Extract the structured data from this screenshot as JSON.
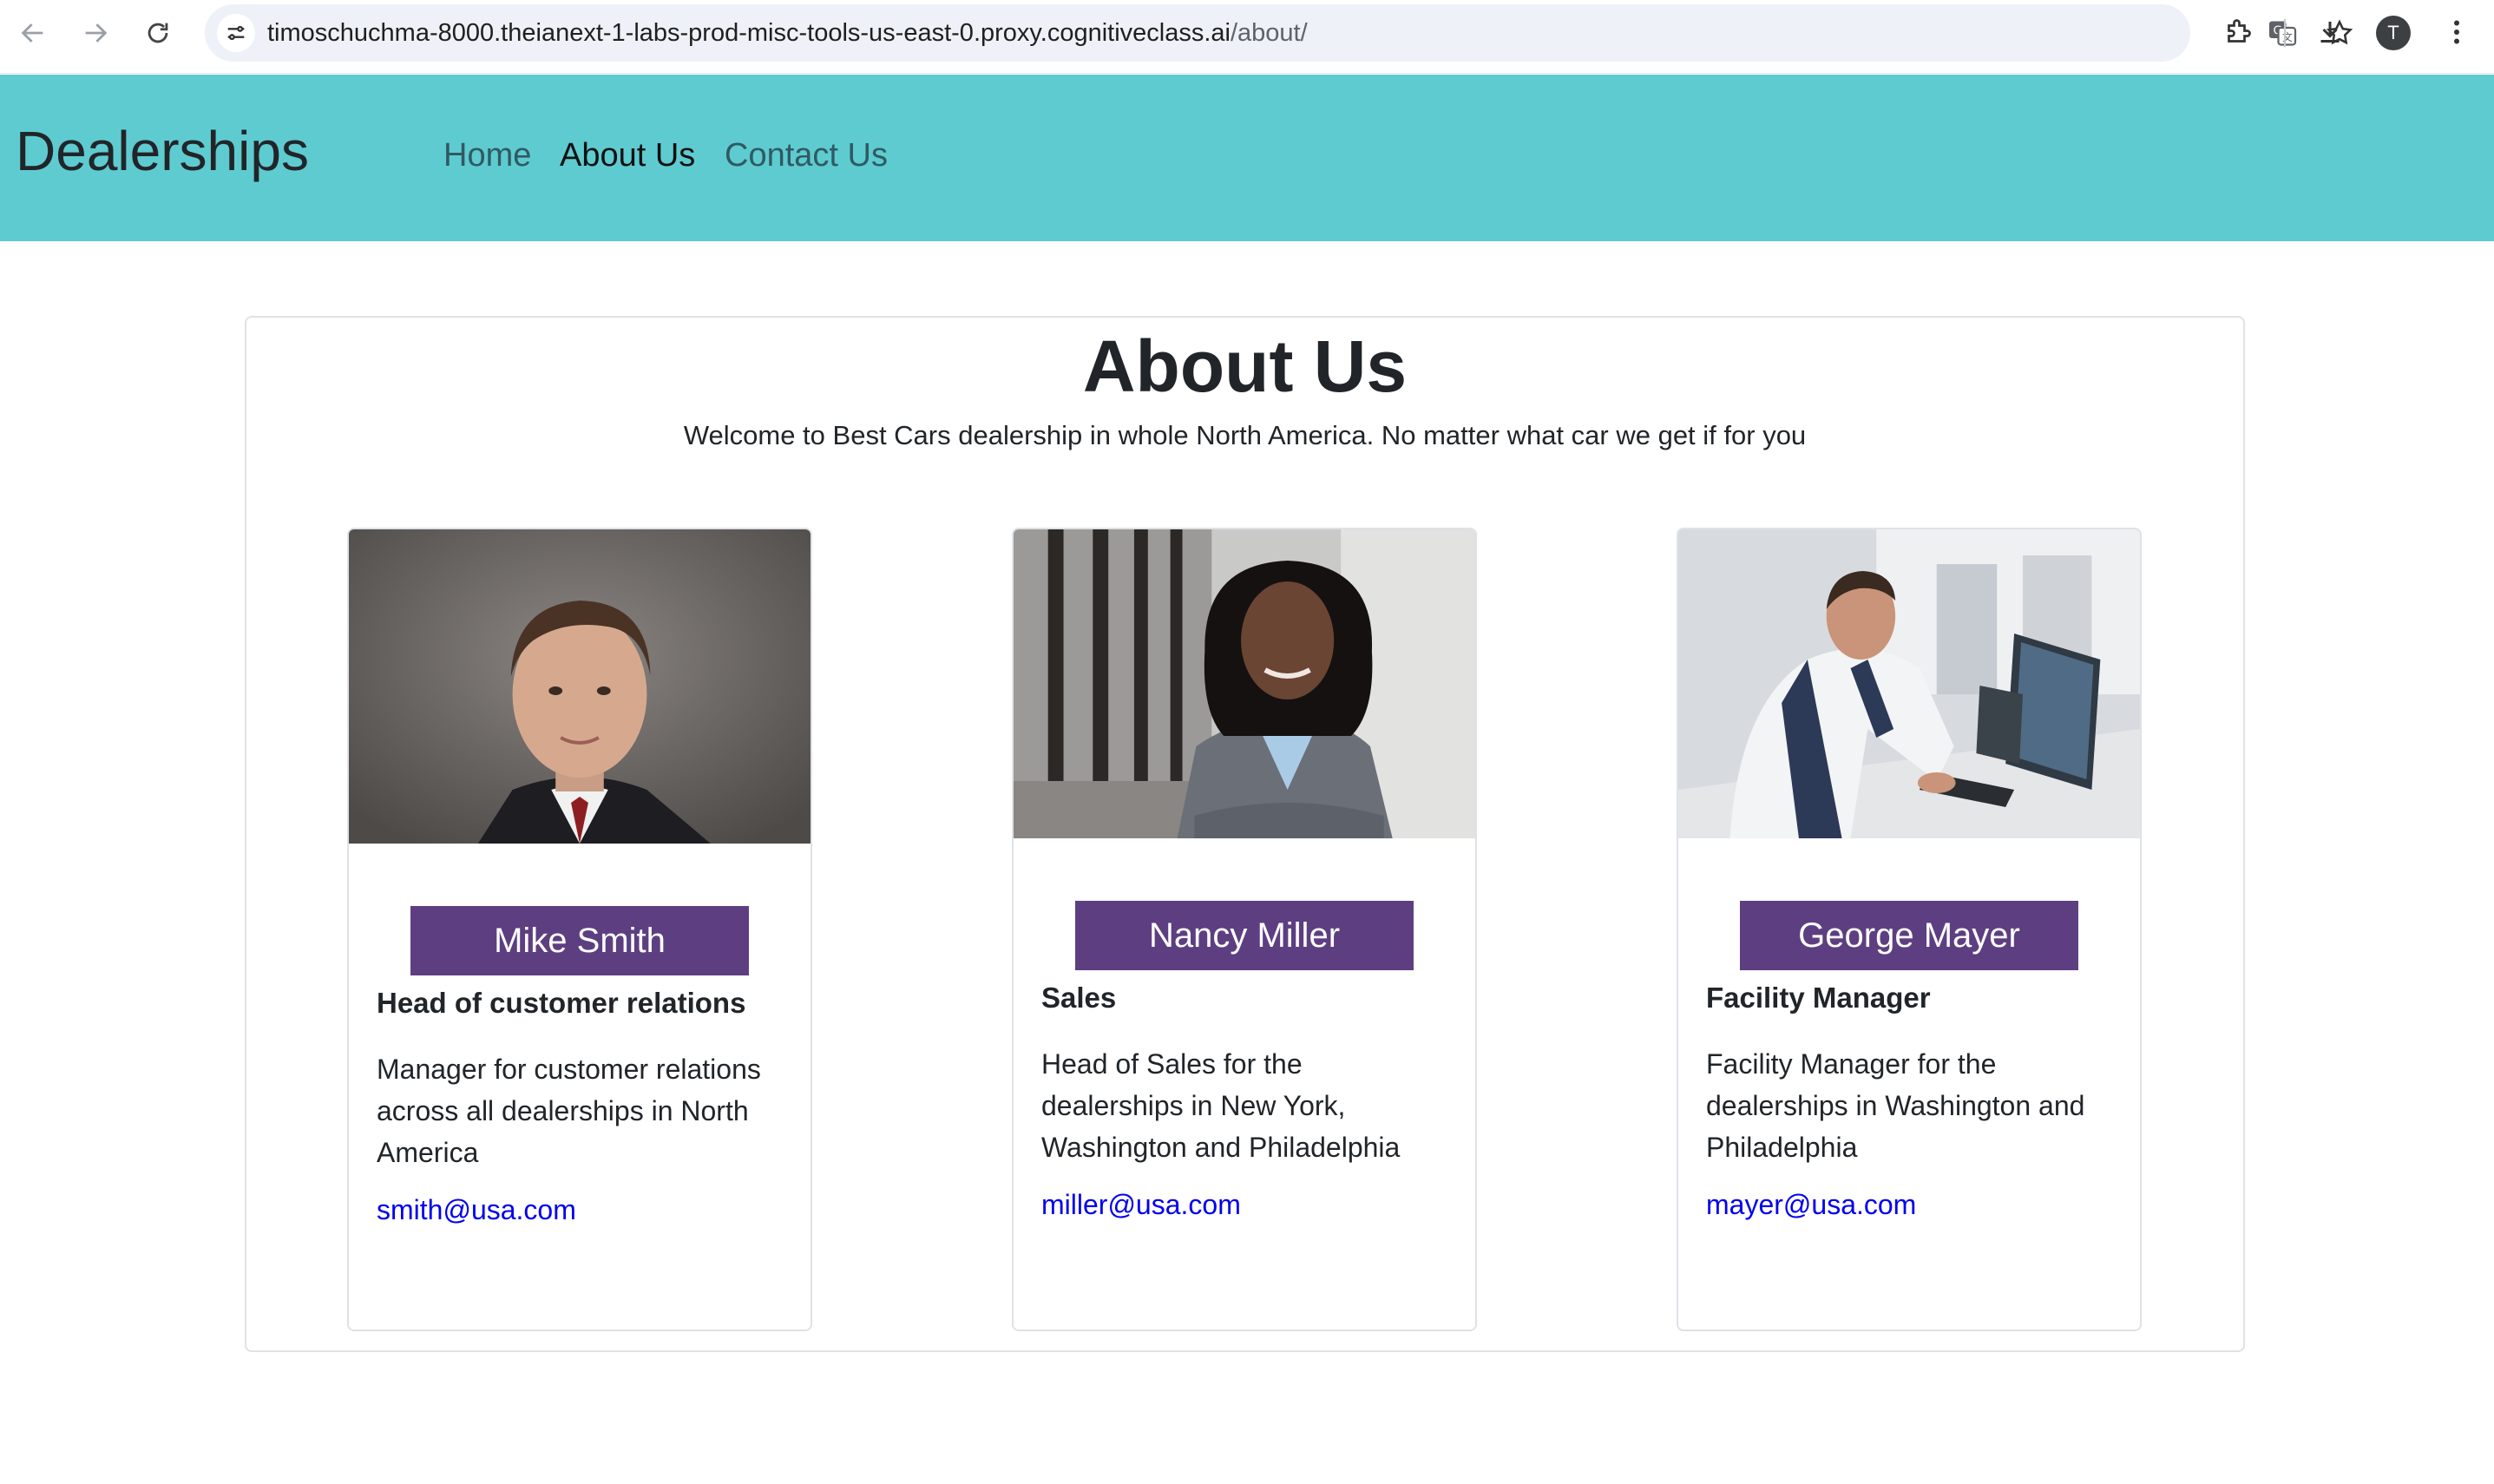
{
  "browser": {
    "url_host": "timoschuchma-8000.theianext-1-labs-prod-misc-tools-us-east-0.proxy.cognitiveclass.ai",
    "url_path": "/about/",
    "avatar_initial": "T",
    "icons": [
      "back-icon",
      "forward-icon",
      "reload-icon",
      "site-settings-icon",
      "translate-icon",
      "bookmark-star-icon",
      "extensions-icon",
      "download-icon",
      "profile-avatar",
      "more-menu-icon"
    ]
  },
  "navbar": {
    "brand": "Dealerships",
    "links": [
      "Home",
      "About Us",
      "Contact Us"
    ],
    "active_link": "About Us",
    "background": "#5ecbd0"
  },
  "about": {
    "title": "About Us",
    "intro": "Welcome to Best Cars dealership in whole North America. No matter what car we get if for you"
  },
  "team": [
    {
      "name": "Mike Smith",
      "role": "Head of customer relations",
      "description": "Manager for customer relations across all dealerships in North America",
      "email": "smith@usa.com"
    },
    {
      "name": "Nancy Miller",
      "role": "Sales",
      "description": "Head of Sales for the dealerships in New York, Washington and Philadelphia",
      "email": "miller@usa.com"
    },
    {
      "name": "George Mayer",
      "role": "Facility Manager",
      "description": "Facility Manager for the dealerships in Washington and Philadelphia",
      "email": "mayer@usa.com"
    }
  ],
  "colors": {
    "name_button": "#5d3f81",
    "link": "#0000ee"
  }
}
